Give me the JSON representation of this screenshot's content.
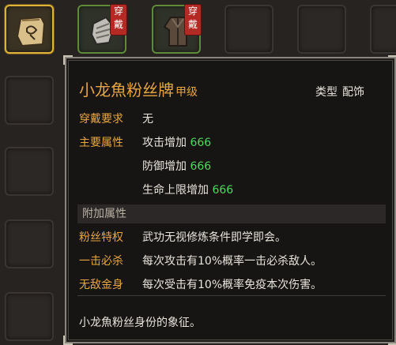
{
  "top_slots": [
    {
      "item": "pouch",
      "selected": true,
      "equipped": false
    },
    {
      "item": "gauntlet",
      "selected": false,
      "equipped": true,
      "badge": [
        "穿",
        "戴"
      ]
    },
    {
      "item": "robe",
      "selected": false,
      "equipped": true,
      "badge": [
        "穿",
        "戴"
      ]
    }
  ],
  "tooltip": {
    "name": "小龙魚粉丝牌",
    "grade": "甲级",
    "type_label": "类型",
    "type_value": "配饰",
    "requirement_label": "穿戴要求",
    "requirement_value": "无",
    "main_attr_label": "主要属性",
    "main_attrs": [
      {
        "label": "攻击增加",
        "value": "666"
      },
      {
        "label": "防御增加",
        "value": "666"
      },
      {
        "label": "生命上限增加",
        "value": "666"
      }
    ],
    "extra_section_title": "附加属性",
    "extra_attrs": [
      {
        "label": "粉丝特权",
        "desc": "武功无视修炼条件即学即会。"
      },
      {
        "label": "一击必杀",
        "desc": "每次攻击有10%概率一击必杀敌人。"
      },
      {
        "label": "无敌金身",
        "desc": "每次受击有10%概率免疫本次伤害。"
      }
    ],
    "description": "小龙魚粉丝身份的象征。"
  },
  "colors": {
    "title": "#e7a540",
    "value_green": "#4fd95a",
    "text": "#e8e4dc",
    "badge": "#b32a25"
  }
}
